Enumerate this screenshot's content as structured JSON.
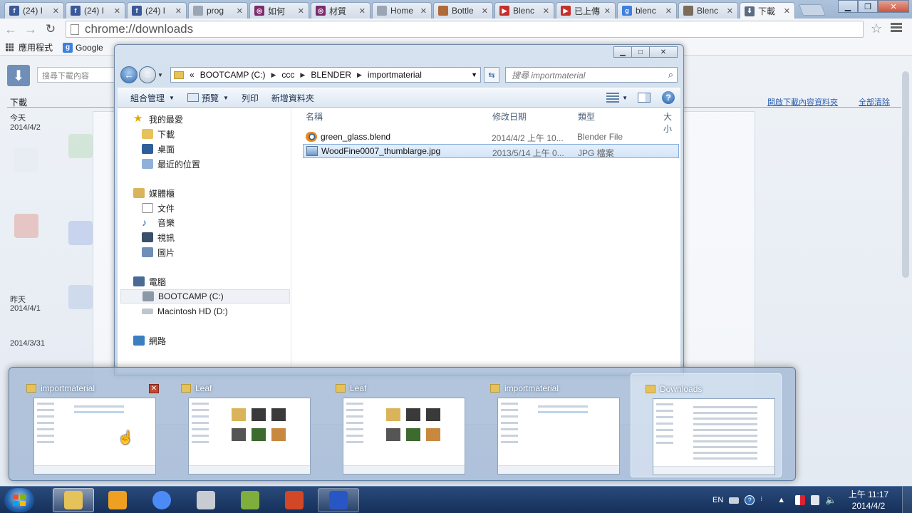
{
  "browser": {
    "tabs": [
      {
        "label": "(24) I",
        "icon": "facebook-icon",
        "color": "#3b5998",
        "glyph": "f"
      },
      {
        "label": "(24) I",
        "icon": "facebook-icon",
        "color": "#3b5998",
        "glyph": "f"
      },
      {
        "label": "(24) I",
        "icon": "facebook-icon",
        "color": "#3b5998",
        "glyph": "f"
      },
      {
        "label": "prog",
        "icon": "page-icon",
        "color": "#9aa6b4",
        "glyph": ""
      },
      {
        "label": "如何",
        "icon": "forum-icon",
        "color": "#7d2b6e",
        "glyph": "◎"
      },
      {
        "label": "材質",
        "icon": "forum-icon",
        "color": "#7d2b6e",
        "glyph": "◎"
      },
      {
        "label": "Home",
        "icon": "page-icon",
        "color": "#9aa6b4",
        "glyph": ""
      },
      {
        "label": "Bottle",
        "icon": "image-icon",
        "color": "#b06a3a",
        "glyph": ""
      },
      {
        "label": "Blenc",
        "icon": "youtube-icon",
        "color": "#c4302b",
        "glyph": "▶"
      },
      {
        "label": "已上傳",
        "icon": "youtube-icon",
        "color": "#c4302b",
        "glyph": "▶"
      },
      {
        "label": "blenc",
        "icon": "google-icon",
        "color": "#3e7fe0",
        "glyph": "g"
      },
      {
        "label": "Blenc",
        "icon": "image-icon",
        "color": "#7a6b5a",
        "glyph": ""
      },
      {
        "label": "下載",
        "icon": "download-icon",
        "color": "#5a6b82",
        "glyph": "⬇"
      }
    ],
    "url": "chrome://downloads",
    "bookmarks": [
      {
        "label": "應用程式"
      },
      {
        "label": "Google"
      }
    ]
  },
  "downloads": {
    "search_placeholder": "搜尋下載內容",
    "title": "下載",
    "open_folder": "開啟下載內容資料夾",
    "clear_all": "全部清除",
    "groups": [
      {
        "heading": "今天",
        "date": "2014/4/2"
      },
      {
        "heading": "昨天",
        "date": "2014/4/1"
      },
      {
        "heading": "",
        "date": "2014/3/31"
      }
    ]
  },
  "explorer": {
    "breadcrumb_prefix": "«",
    "breadcrumb": [
      "BOOTCAMP (C:)",
      "ccc",
      "BLENDER",
      "importmaterial"
    ],
    "search_placeholder": "搜尋 importmaterial",
    "commands": [
      "組合管理",
      "預覽",
      "列印",
      "新增資料夾"
    ],
    "nav": {
      "favorites": "我的最愛",
      "favorites_items": [
        "下載",
        "桌面",
        "最近的位置"
      ],
      "libraries": "媒體櫃",
      "libraries_items": [
        "文件",
        "音樂",
        "視訊",
        "圖片"
      ],
      "computer": "電腦",
      "computer_items": [
        "BOOTCAMP (C:)",
        "Macintosh HD (D:)"
      ],
      "network": "網路"
    },
    "columns": [
      "名稱",
      "修改日期",
      "類型",
      "大小"
    ],
    "files": [
      {
        "name": "green_glass.blend",
        "date": "2014/4/2 上午 10...",
        "type": "Blender File",
        "icon": "blender-icon",
        "selected": false
      },
      {
        "name": "WoodFine0007_thumblarge.jpg",
        "date": "2013/5/14 上午 0...",
        "type": "JPG 檔案",
        "icon": "image-file-icon",
        "selected": true
      }
    ]
  },
  "thumbnails": [
    {
      "title": "importmaterial",
      "kind": "list",
      "close": true
    },
    {
      "title": "Leaf",
      "kind": "grid",
      "close": false
    },
    {
      "title": "Leaf",
      "kind": "grid",
      "close": false
    },
    {
      "title": "importmaterial",
      "kind": "list",
      "close": false
    },
    {
      "title": "Downloads",
      "kind": "downloads",
      "close": false
    }
  ],
  "taskbar": {
    "language": "EN",
    "time": "上午 11:17",
    "date": "2014/4/2",
    "apps": [
      {
        "name": "explorer",
        "color": "#e6c25a",
        "state": "active"
      },
      {
        "name": "media-player",
        "color": "#f0a020",
        "state": ""
      },
      {
        "name": "chrome",
        "color": "#4c8bf5",
        "state": ""
      },
      {
        "name": "camera-app",
        "color": "#c8ccd2",
        "state": ""
      },
      {
        "name": "notepad-app",
        "color": "#7fae3c",
        "state": ""
      },
      {
        "name": "presentation-app",
        "color": "#d24726",
        "state": ""
      },
      {
        "name": "remote-app",
        "color": "#2856c4",
        "state": "open"
      }
    ]
  }
}
